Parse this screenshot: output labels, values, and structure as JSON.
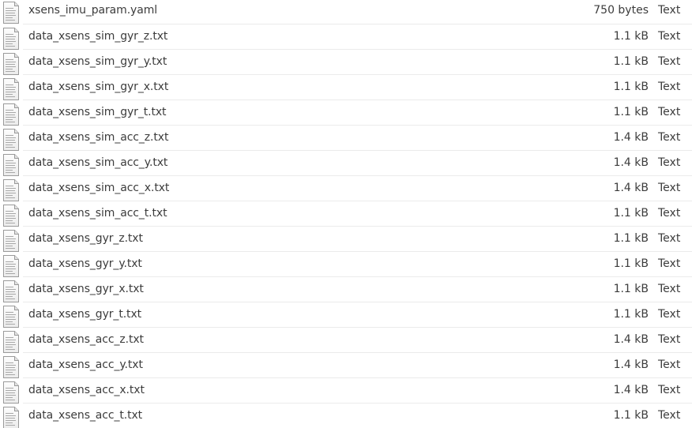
{
  "files": [
    {
      "name": "xsens_imu_param.yaml",
      "size": "750 bytes",
      "type": "Text",
      "icon": "text-file-icon"
    },
    {
      "name": "data_xsens_sim_gyr_z.txt",
      "size": "1.1 kB",
      "type": "Text",
      "icon": "text-file-icon"
    },
    {
      "name": "data_xsens_sim_gyr_y.txt",
      "size": "1.1 kB",
      "type": "Text",
      "icon": "text-file-icon"
    },
    {
      "name": "data_xsens_sim_gyr_x.txt",
      "size": "1.1 kB",
      "type": "Text",
      "icon": "text-file-icon"
    },
    {
      "name": "data_xsens_sim_gyr_t.txt",
      "size": "1.1 kB",
      "type": "Text",
      "icon": "text-file-icon"
    },
    {
      "name": "data_xsens_sim_acc_z.txt",
      "size": "1.4 kB",
      "type": "Text",
      "icon": "text-file-icon"
    },
    {
      "name": "data_xsens_sim_acc_y.txt",
      "size": "1.4 kB",
      "type": "Text",
      "icon": "text-file-icon"
    },
    {
      "name": "data_xsens_sim_acc_x.txt",
      "size": "1.4 kB",
      "type": "Text",
      "icon": "text-file-icon"
    },
    {
      "name": "data_xsens_sim_acc_t.txt",
      "size": "1.1 kB",
      "type": "Text",
      "icon": "text-file-icon"
    },
    {
      "name": "data_xsens_gyr_z.txt",
      "size": "1.1 kB",
      "type": "Text",
      "icon": "text-file-icon"
    },
    {
      "name": "data_xsens_gyr_y.txt",
      "size": "1.1 kB",
      "type": "Text",
      "icon": "text-file-icon"
    },
    {
      "name": "data_xsens_gyr_x.txt",
      "size": "1.1 kB",
      "type": "Text",
      "icon": "text-file-icon"
    },
    {
      "name": "data_xsens_gyr_t.txt",
      "size": "1.1 kB",
      "type": "Text",
      "icon": "text-file-icon"
    },
    {
      "name": "data_xsens_acc_z.txt",
      "size": "1.4 kB",
      "type": "Text",
      "icon": "text-file-icon"
    },
    {
      "name": "data_xsens_acc_y.txt",
      "size": "1.4 kB",
      "type": "Text",
      "icon": "text-file-icon"
    },
    {
      "name": "data_xsens_acc_x.txt",
      "size": "1.4 kB",
      "type": "Text",
      "icon": "text-file-icon"
    },
    {
      "name": "data_xsens_acc_t.txt",
      "size": "1.1 kB",
      "type": "Text",
      "icon": "text-file-icon"
    }
  ],
  "colors": {
    "text": "#3c3c3c",
    "separator": "#ebebeb",
    "background": "#ffffff"
  }
}
